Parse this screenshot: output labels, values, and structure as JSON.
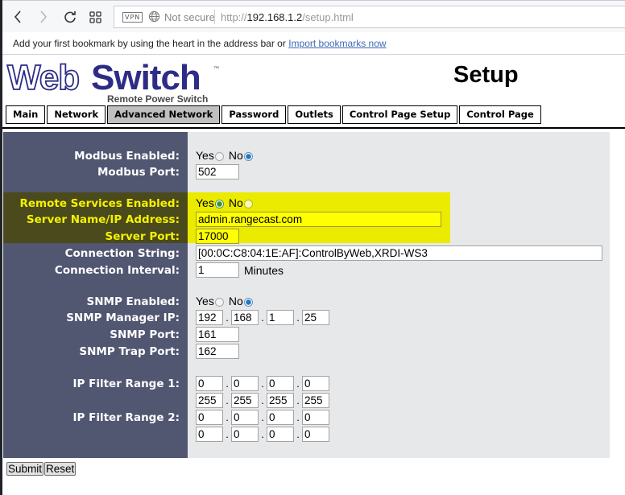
{
  "browser": {
    "back_icon": "chevron-left-icon",
    "forward_icon": "chevron-right-icon",
    "reload_icon": "reload-icon",
    "speed_dial_icon": "grid-icon",
    "vpn_badge": "VPN",
    "security_label": "Not secure",
    "url_scheme": "http://",
    "url_host": "192.168.1.2",
    "url_path": "/setup.html",
    "bookmark_message": "Add your first bookmark by using the heart in the address bar or",
    "bookmark_link": "Import bookmarks now"
  },
  "header": {
    "logo_web": "Web",
    "logo_switch": "Switch",
    "logo_tm": "™",
    "logo_tagline": "Remote Power Switch",
    "title": "Setup"
  },
  "tabs": [
    {
      "label": "Main",
      "active": false
    },
    {
      "label": "Network",
      "active": false
    },
    {
      "label": "Advanced Network",
      "active": true
    },
    {
      "label": "Password",
      "active": false
    },
    {
      "label": "Outlets",
      "active": false
    },
    {
      "label": "Control Page Setup",
      "active": false
    },
    {
      "label": "Control Page",
      "active": false
    }
  ],
  "form": {
    "modbus_enabled": {
      "label": "Modbus Enabled:",
      "yes": "Yes",
      "no": "No",
      "selected": "No"
    },
    "modbus_port": {
      "label": "Modbus Port:",
      "value": "502"
    },
    "remote_services_enabled": {
      "label": "Remote Services Enabled:",
      "yes": "Yes",
      "no": "No",
      "selected": "Yes"
    },
    "server_name": {
      "label": "Server Name/IP Address:",
      "value": "admin.rangecast.com"
    },
    "server_port": {
      "label": "Server Port:",
      "value": "17000"
    },
    "connection_string": {
      "label": "Connection String:",
      "value": "[00:0C:C8:04:1E:AF]:ControlByWeb,XRDI-WS3"
    },
    "connection_interval": {
      "label": "Connection Interval:",
      "value": "1",
      "unit": "Minutes"
    },
    "snmp_enabled": {
      "label": "SNMP Enabled:",
      "yes": "Yes",
      "no": "No",
      "selected": "No"
    },
    "snmp_manager_ip": {
      "label": "SNMP Manager IP:",
      "octets": [
        "192",
        "168",
        "1",
        "25"
      ]
    },
    "snmp_port": {
      "label": "SNMP Port:",
      "value": "161"
    },
    "snmp_trap_port": {
      "label": "SNMP Trap Port:",
      "value": "162"
    },
    "ip_filter_1": {
      "label": "IP Filter Range 1:",
      "start": [
        "0",
        "0",
        "0",
        "0"
      ],
      "end": [
        "255",
        "255",
        "255",
        "255"
      ]
    },
    "ip_filter_2": {
      "label": "IP Filter Range 2:",
      "start": [
        "0",
        "0",
        "0",
        "0"
      ],
      "end": [
        "0",
        "0",
        "0",
        "0"
      ]
    },
    "ip_separator": "."
  },
  "actions": {
    "submit": "Submit",
    "reset": "Reset"
  },
  "colors": {
    "label_bg": "#515671",
    "value_bg": "#e7e8ea",
    "highlight": "#ebeb00",
    "highlight_label_bg": "#4b4a1c",
    "highlight_label_text": "#f3f300",
    "logo_blue": "#2d2d86",
    "active_tab": "#c0c0c0"
  }
}
